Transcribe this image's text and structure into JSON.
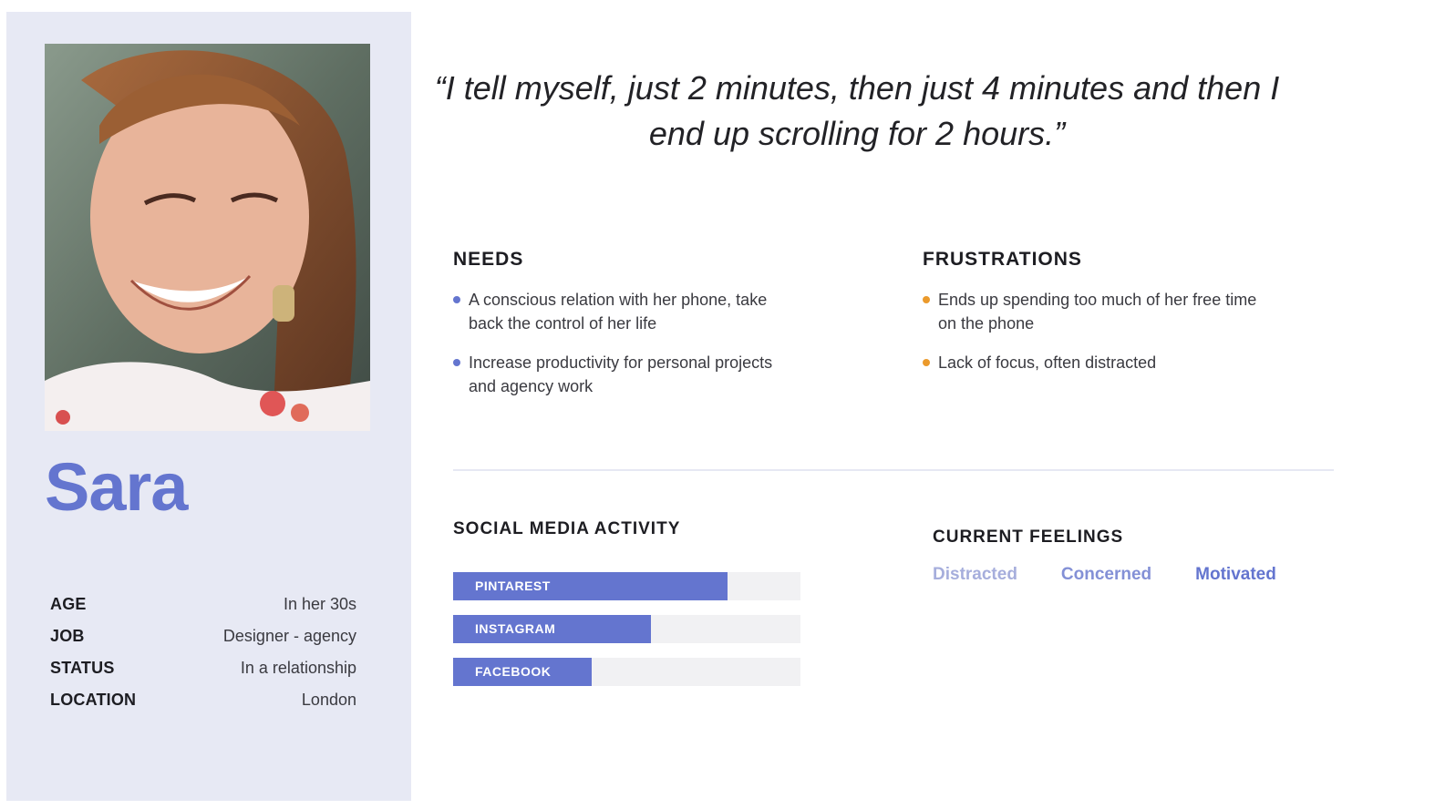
{
  "persona": {
    "name": "Sara",
    "photo": "persona-photo",
    "details": [
      {
        "label": "AGE",
        "value": "In her 30s"
      },
      {
        "label": "JOB",
        "value": "Designer - agency"
      },
      {
        "label": "STATUS",
        "value": "In a relationship"
      },
      {
        "label": "LOCATION",
        "value": "London"
      }
    ]
  },
  "quote": "“I tell myself, just 2 minutes, then just 4 minutes and then I end up scrolling for 2 hours.”",
  "needs": {
    "title": "NEEDS",
    "items": [
      "A conscious relation with her phone, take back the control of her life",
      "Increase productivity for personal projects and agency work"
    ]
  },
  "frustrations": {
    "title": "FRUSTRATIONS",
    "items": [
      "Ends up spending too much of her free time on the phone",
      "Lack of focus, often distracted"
    ]
  },
  "social_media": {
    "title": "SOCIAL MEDIA ACTIVITY",
    "items": [
      {
        "label": "PINTAREST",
        "level_pct": 79
      },
      {
        "label": "INSTAGRAM",
        "level_pct": 57
      },
      {
        "label": "FACEBOOK",
        "level_pct": 40
      }
    ]
  },
  "feelings": {
    "title": "CURRENT FEELINGS",
    "items": [
      "Distracted",
      "Concerned",
      "Motivated"
    ]
  },
  "colors": {
    "accent": "#6475cf",
    "sidebar_bg": "#e7e9f4",
    "frustration_bullet": "#eb9a2c",
    "bar_track": "#f1f1f3"
  }
}
